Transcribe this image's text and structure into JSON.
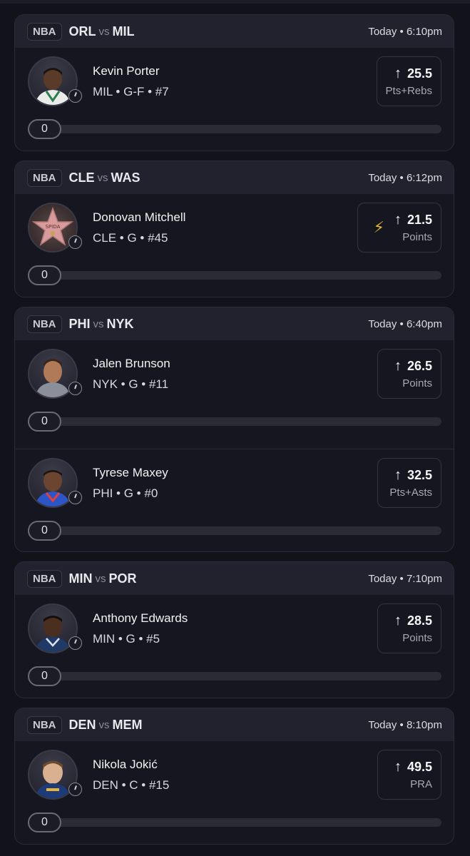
{
  "games": [
    {
      "league": "NBA",
      "home": "ORL",
      "vs": "vs",
      "away": "MIL",
      "time": "Today • 6:10pm",
      "players": [
        {
          "name": "Kevin Porter",
          "meta": "MIL • G-F • #7",
          "line": "25.5",
          "stat": "Pts+Rebs",
          "boost": false,
          "progress": "0",
          "jersey": "#2e7d4f"
        }
      ]
    },
    {
      "league": "NBA",
      "home": "CLE",
      "vs": "vs",
      "away": "WAS",
      "time": "Today • 6:12pm",
      "players": [
        {
          "name": "Donovan Mitchell",
          "meta": "CLE • G • #45",
          "line": "21.5",
          "stat": "Points",
          "boost": true,
          "progress": "0",
          "star_text": "SPIDA"
        }
      ]
    },
    {
      "league": "NBA",
      "home": "PHI",
      "vs": "vs",
      "away": "NYK",
      "time": "Today • 6:40pm",
      "players": [
        {
          "name": "Jalen Brunson",
          "meta": "NYK • G • #11",
          "line": "26.5",
          "stat": "Points",
          "boost": false,
          "progress": "0",
          "jersey": "#8a8f99"
        },
        {
          "name": "Tyrese Maxey",
          "meta": "PHI • G • #0",
          "line": "32.5",
          "stat": "Pts+Asts",
          "boost": false,
          "progress": "0",
          "jersey": "#2c55c7"
        }
      ]
    },
    {
      "league": "NBA",
      "home": "MIN",
      "vs": "vs",
      "away": "POR",
      "time": "Today • 7:10pm",
      "players": [
        {
          "name": "Anthony Edwards",
          "meta": "MIN • G • #5",
          "line": "28.5",
          "stat": "Points",
          "boost": false,
          "progress": "0",
          "jersey": "#1f3a66"
        }
      ]
    },
    {
      "league": "NBA",
      "home": "DEN",
      "vs": "vs",
      "away": "MEM",
      "time": "Today • 8:10pm",
      "players": [
        {
          "name": "Nikola Jokić",
          "meta": "DEN • C • #15",
          "line": "49.5",
          "stat": "PRA",
          "boost": false,
          "progress": "0",
          "jersey": "#1d3b78"
        }
      ]
    }
  ],
  "icons": {
    "arrow": "arrow-up-icon",
    "bolt": "lightning-bolt-icon",
    "clock": "clock-icon"
  },
  "colors": {
    "background": "#12121b",
    "card": "#161620",
    "header": "#22222e",
    "bolt": "#e7b33a"
  }
}
